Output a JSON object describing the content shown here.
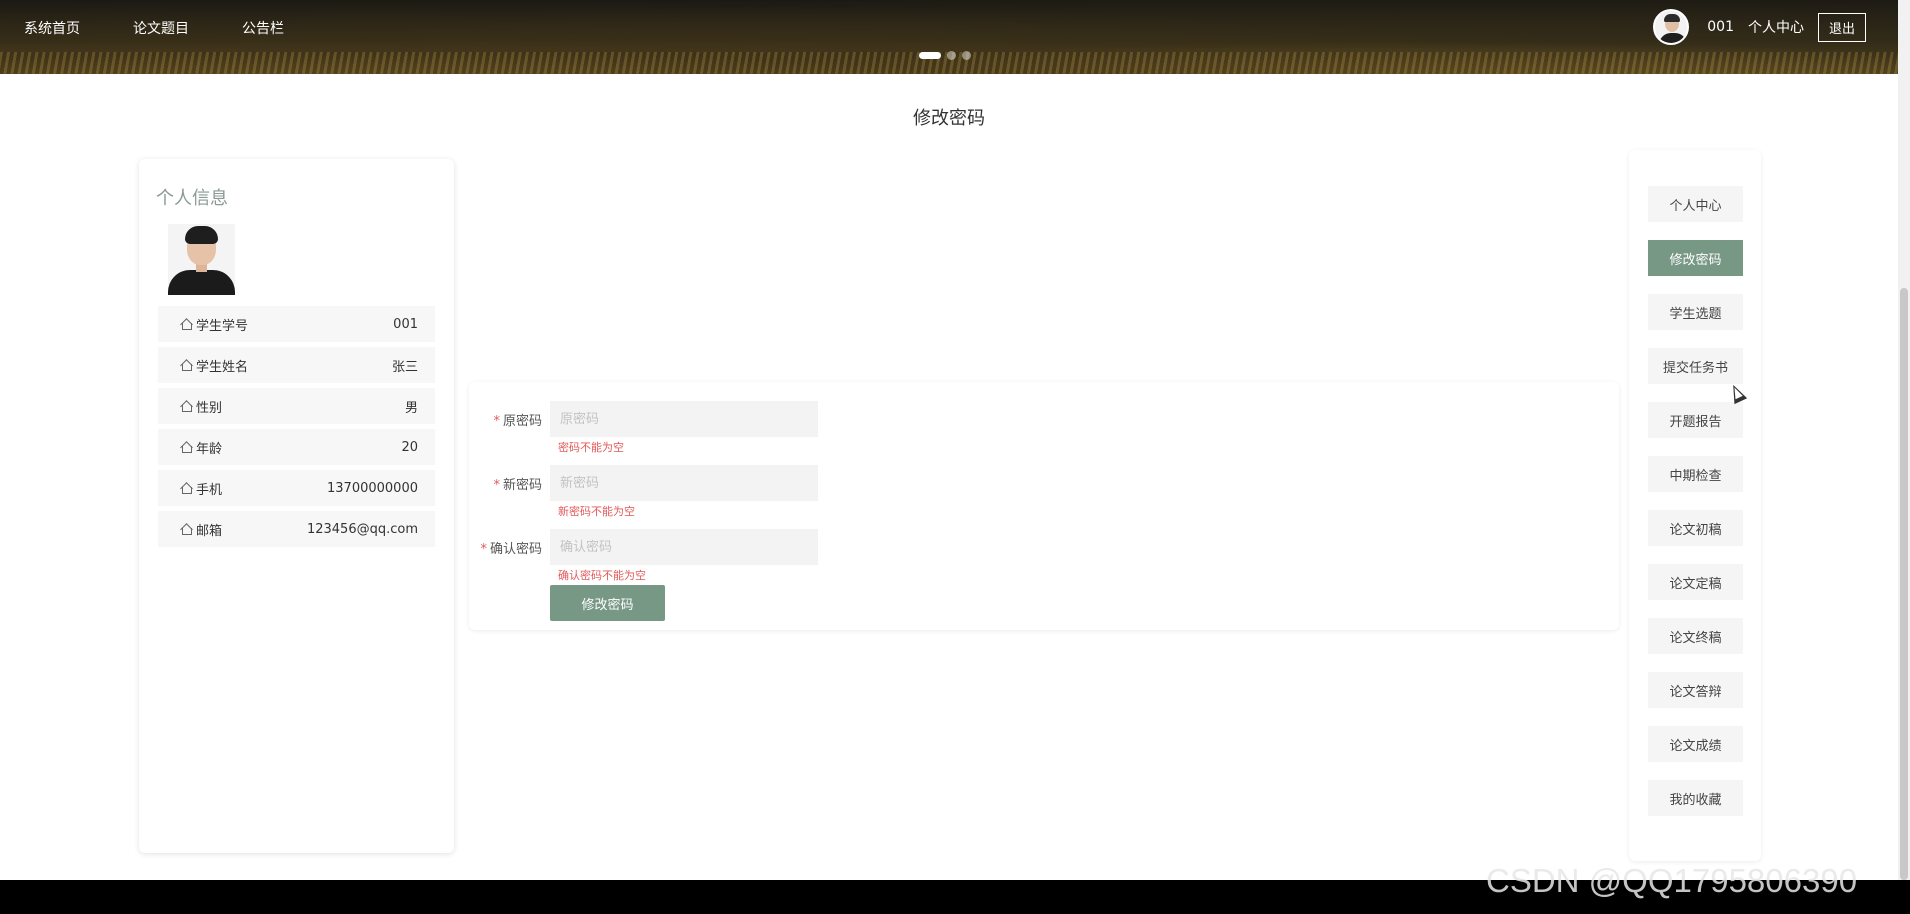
{
  "header": {
    "nav": [
      "系统首页",
      "论文题目",
      "公告栏"
    ],
    "user_id": "001",
    "user_center": "个人中心",
    "logout": "退出"
  },
  "page_title": "修改密码",
  "profile": {
    "title": "个人信息",
    "fields": [
      {
        "label": "学生学号",
        "value": "001"
      },
      {
        "label": "学生姓名",
        "value": "张三"
      },
      {
        "label": "性别",
        "value": "男"
      },
      {
        "label": "年龄",
        "value": "20"
      },
      {
        "label": "手机",
        "value": "13700000000"
      },
      {
        "label": "邮箱",
        "value": "123456@qq.com"
      }
    ]
  },
  "form": {
    "old_password": {
      "label": "原密码",
      "placeholder": "原密码",
      "error": "密码不能为空",
      "required": "*"
    },
    "new_password": {
      "label": "新密码",
      "placeholder": "新密码",
      "error": "新密码不能为空",
      "required": "*"
    },
    "confirm_password": {
      "label": "确认密码",
      "placeholder": "确认密码",
      "error": "确认密码不能为空",
      "required": "*"
    },
    "submit_label": "修改密码"
  },
  "menu": {
    "items": [
      "个人中心",
      "修改密码",
      "学生选题",
      "提交任务书",
      "开题报告",
      "中期检查",
      "论文初稿",
      "论文定稿",
      "论文终稿",
      "论文答辩",
      "论文成绩",
      "我的收藏"
    ],
    "active_index": 1
  },
  "watermark": "CSDN @QQ1795806390",
  "colors": {
    "accent": "#789886",
    "error": "#e15a5a"
  }
}
